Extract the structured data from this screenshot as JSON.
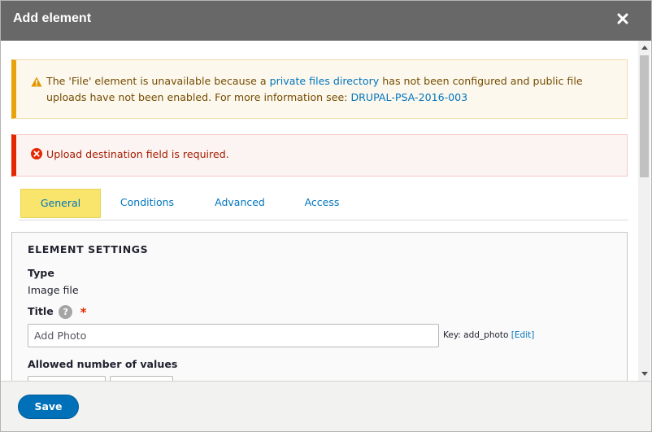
{
  "dialog": {
    "title": "Add element"
  },
  "warning": {
    "text_before": "The 'File' element is unavailable because a ",
    "link1": "private files directory",
    "text_middle": " has not been configured and public file uploads have not been enabled. For more information see: ",
    "link2": "DRUPAL-PSA-2016-003"
  },
  "error": {
    "text": "Upload destination field is required."
  },
  "tabs": [
    {
      "label": "General",
      "active": true
    },
    {
      "label": "Conditions",
      "active": false
    },
    {
      "label": "Advanced",
      "active": false
    },
    {
      "label": "Access",
      "active": false
    }
  ],
  "element_settings": {
    "legend": "ELEMENT SETTINGS",
    "type_label": "Type",
    "type_value": "Image file",
    "title_label": "Title",
    "help_glyph": "?",
    "required_marker": "*",
    "title_value": "Add Photo",
    "key_text": "Key: add_photo",
    "edit_link": "[Edit]",
    "allowed_label": "Allowed number of values"
  },
  "footer": {
    "save_label": "Save"
  },
  "colors": {
    "titlebar": "#686868",
    "link": "#0074bd",
    "active_tab": "#f9e56b",
    "warning_border": "#e6a30c",
    "error_border": "#e62600",
    "save_button": "#0071b8"
  }
}
